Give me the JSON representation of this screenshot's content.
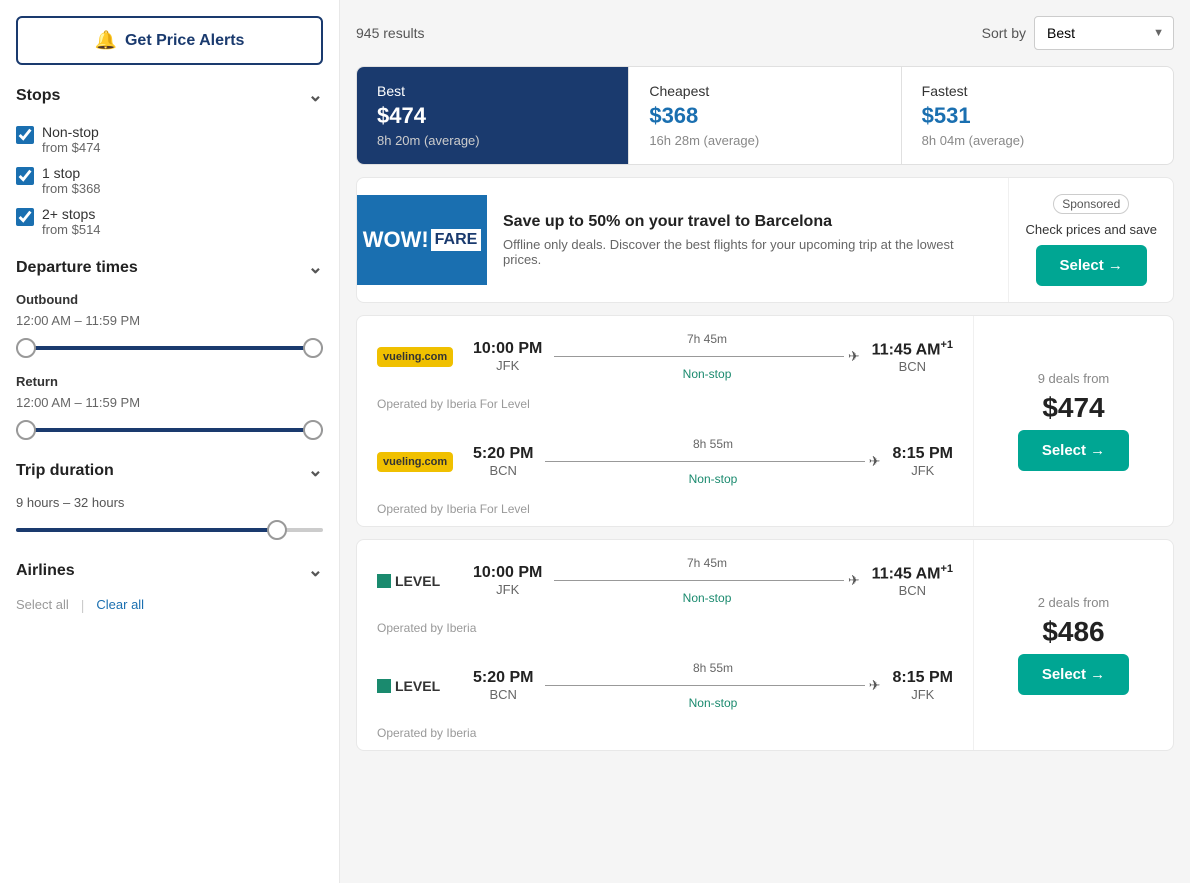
{
  "sidebar": {
    "price_alert_btn": "Get Price Alerts",
    "stops_section": {
      "title": "Stops",
      "options": [
        {
          "label": "Non-stop",
          "price": "from $474",
          "checked": true
        },
        {
          "label": "1 stop",
          "price": "from $368",
          "checked": true
        },
        {
          "label": "2+ stops",
          "price": "from $514",
          "checked": true
        }
      ]
    },
    "departure_section": {
      "title": "Departure times",
      "outbound": {
        "label": "Outbound",
        "range": "12:00 AM – 11:59 PM"
      },
      "return": {
        "label": "Return",
        "range": "12:00 AM – 11:59 PM"
      }
    },
    "trip_duration_section": {
      "title": "Trip duration",
      "range": "9 hours – 32 hours"
    },
    "airlines_section": {
      "title": "Airlines",
      "select_all": "Select all",
      "clear_all": "Clear all"
    }
  },
  "main": {
    "results_count": "945 results",
    "sort_label": "Sort by",
    "sort_value": "Best",
    "tabs": [
      {
        "label": "Best",
        "price": "$474",
        "duration": "8h 20m (average)",
        "active": true
      },
      {
        "label": "Cheapest",
        "price": "$368",
        "duration": "16h 28m (average)",
        "active": false
      },
      {
        "label": "Fastest",
        "price": "$531",
        "duration": "8h 04m (average)",
        "active": false
      }
    ],
    "ad": {
      "logo_wow": "WOW!",
      "logo_fare": "FARE",
      "title": "Save up to 50% on your travel to Barcelona",
      "description": "Offline only deals. Discover the best flights for your upcoming trip at the lowest prices.",
      "sponsored_label": "Sponsored",
      "subtitle": "Check prices and save",
      "select_label": "Select →"
    },
    "flight_results": [
      {
        "outbound": {
          "airline_type": "vueling",
          "airline_label": "vueling.com",
          "depart_time": "10:00 PM",
          "depart_airport": "JFK",
          "duration": "7h 45m",
          "stop_type": "Non-stop",
          "arrive_time": "11:45 AM",
          "arrive_super": "+1",
          "arrive_airport": "BCN",
          "operated_by": "Operated by Iberia For Level"
        },
        "return": {
          "airline_type": "vueling",
          "airline_label": "vueling.com",
          "depart_time": "5:20 PM",
          "depart_airport": "BCN",
          "duration": "8h 55m",
          "stop_type": "Non-stop",
          "arrive_time": "8:15 PM",
          "arrive_super": "",
          "arrive_airport": "JFK",
          "operated_by": "Operated by Iberia For Level"
        },
        "deals_from": "9 deals from",
        "price": "$474",
        "select_label": "Select →"
      },
      {
        "outbound": {
          "airline_type": "level",
          "airline_label": "LEVEL",
          "depart_time": "10:00 PM",
          "depart_airport": "JFK",
          "duration": "7h 45m",
          "stop_type": "Non-stop",
          "arrive_time": "11:45 AM",
          "arrive_super": "+1",
          "arrive_airport": "BCN",
          "operated_by": "Operated by Iberia"
        },
        "return": {
          "airline_type": "level",
          "airline_label": "LEVEL",
          "depart_time": "5:20 PM",
          "depart_airport": "BCN",
          "duration": "8h 55m",
          "stop_type": "Non-stop",
          "arrive_time": "8:15 PM",
          "arrive_super": "",
          "arrive_airport": "JFK",
          "operated_by": "Operated by Iberia"
        },
        "deals_from": "2 deals from",
        "price": "$486",
        "select_label": "Select →"
      }
    ]
  }
}
